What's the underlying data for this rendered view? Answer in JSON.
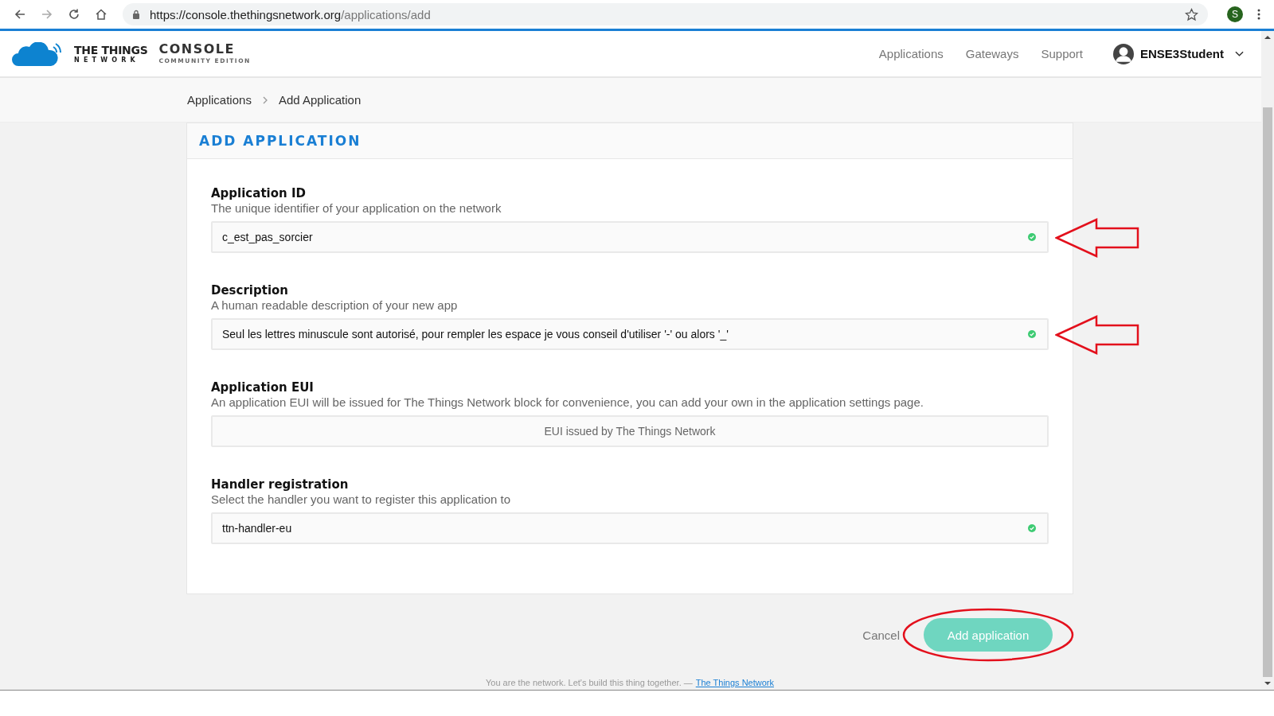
{
  "browser": {
    "url_host": "https://console.thethingsnetwork.org",
    "url_path": "/applications/add",
    "profile_initial": "S"
  },
  "header": {
    "brand_top": "THE THINGS",
    "brand_bottom": "NETWORK",
    "console": "CONSOLE",
    "edition": "COMMUNITY EDITION",
    "nav": [
      "Applications",
      "Gateways",
      "Support"
    ],
    "user": "ENSE3Student"
  },
  "breadcrumb": [
    "Applications",
    "Add Application"
  ],
  "form": {
    "title": "ADD APPLICATION",
    "fields": [
      {
        "label": "Application ID",
        "help": "The unique identifier of your application on the network",
        "value": "c_est_pas_sorcier",
        "valid": true,
        "annotated": true
      },
      {
        "label": "Description",
        "help": "A human readable description of your new app",
        "value": "Seul les lettres minuscule sont autorisé, pour rempler les espace je vous conseil d'utiliser '-' ou alors '_'",
        "valid": true,
        "annotated": true
      },
      {
        "label": "Application EUI",
        "help": "An application EUI will be issued for The Things Network block for convenience, you can add your own in the application settings page.",
        "placeholder": "EUI issued by The Things Network",
        "valid": false,
        "annotated": false
      },
      {
        "label": "Handler registration",
        "help": "Select the handler you want to register this application to",
        "value": "ttn-handler-eu",
        "valid": true,
        "annotated": false
      }
    ]
  },
  "actions": {
    "cancel": "Cancel",
    "submit": "Add application",
    "submit_circled": true
  },
  "footer": {
    "text": "You are the network. Let's build this thing together. —",
    "link": "The Things Network"
  }
}
